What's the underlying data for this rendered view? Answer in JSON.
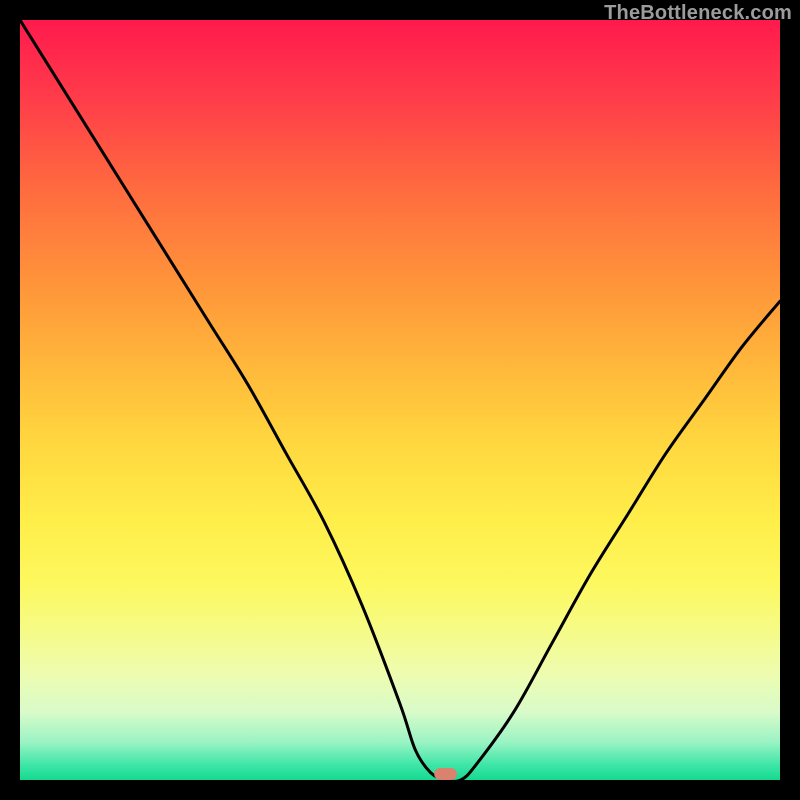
{
  "watermark": "TheBottleneck.com",
  "chart_data": {
    "type": "line",
    "title": "",
    "xlabel": "",
    "ylabel": "",
    "xlim": [
      0,
      100
    ],
    "ylim": [
      0,
      100
    ],
    "x": [
      0,
      5,
      10,
      15,
      20,
      25,
      30,
      35,
      40,
      45,
      50,
      52,
      54,
      56,
      58,
      60,
      65,
      70,
      75,
      80,
      85,
      90,
      95,
      100
    ],
    "values": [
      100,
      92,
      84,
      76,
      68,
      60,
      52,
      43,
      34,
      23,
      10,
      4,
      1,
      0,
      0,
      2,
      9,
      18,
      27,
      35,
      43,
      50,
      57,
      63
    ],
    "notch": {
      "x": 56,
      "width": 3,
      "color": "#d9826e"
    },
    "grid": false,
    "legend": false
  }
}
